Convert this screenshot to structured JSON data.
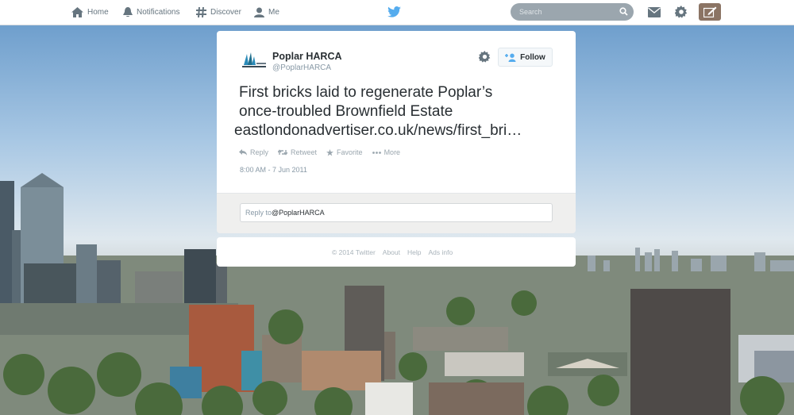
{
  "nav": {
    "home": "Home",
    "notifications": "Notifications",
    "discover": "Discover",
    "me": "Me"
  },
  "search": {
    "placeholder": "Search"
  },
  "colors": {
    "brand": "#55acee",
    "compose": "#8b7464"
  },
  "tweet": {
    "author_name": "Poplar HARCA",
    "author_handle": "@PoplarHARCA",
    "follow_label": "Follow",
    "text_line1": "First bricks laid to regenerate Poplar’s",
    "text_line2": "once-troubled Brownfield Estate",
    "link": "eastlondonadvertiser.co.uk/news/first_bri…",
    "actions": {
      "reply": "Reply",
      "retweet": "Retweet",
      "favorite": "Favorite",
      "more": "More"
    },
    "timestamp": "8:00 AM - 7 Jun 2011"
  },
  "reply_box": {
    "prefix": "Reply to ",
    "mention": "@PoplarHARCA"
  },
  "footer": {
    "copyright": "© 2014 Twitter",
    "about": "About",
    "help": "Help",
    "ads": "Ads info"
  }
}
